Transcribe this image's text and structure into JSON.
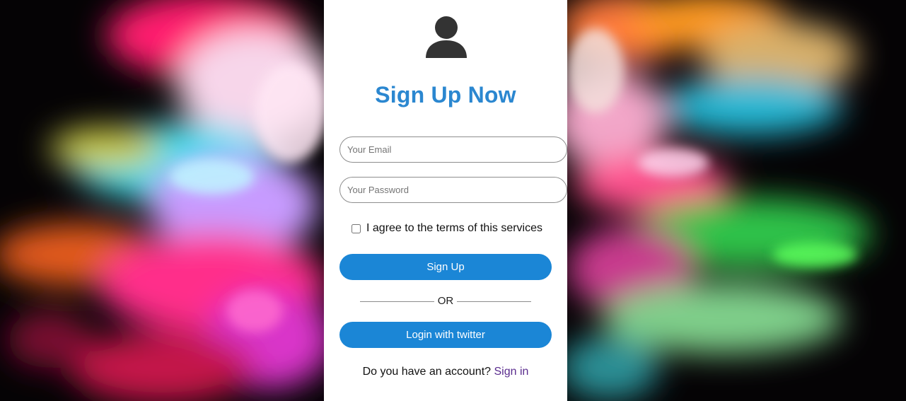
{
  "signup": {
    "title": "Sign Up Now",
    "email_placeholder": "Your Email",
    "password_placeholder": "Your Password",
    "terms_label": "I agree to the terms of this services",
    "terms_checked": false,
    "signup_button": "Sign Up",
    "or_text": "OR",
    "twitter_button": "Login with twitter",
    "account_question": "Do you have an account?",
    "signin_link": "Sign in"
  },
  "icons": {
    "avatar": "user-avatar-icon"
  },
  "colors": {
    "title": "#2b87d0",
    "button": "#1b86d6",
    "signin_link": "#5a2c8e",
    "panel": "#ffffff"
  }
}
